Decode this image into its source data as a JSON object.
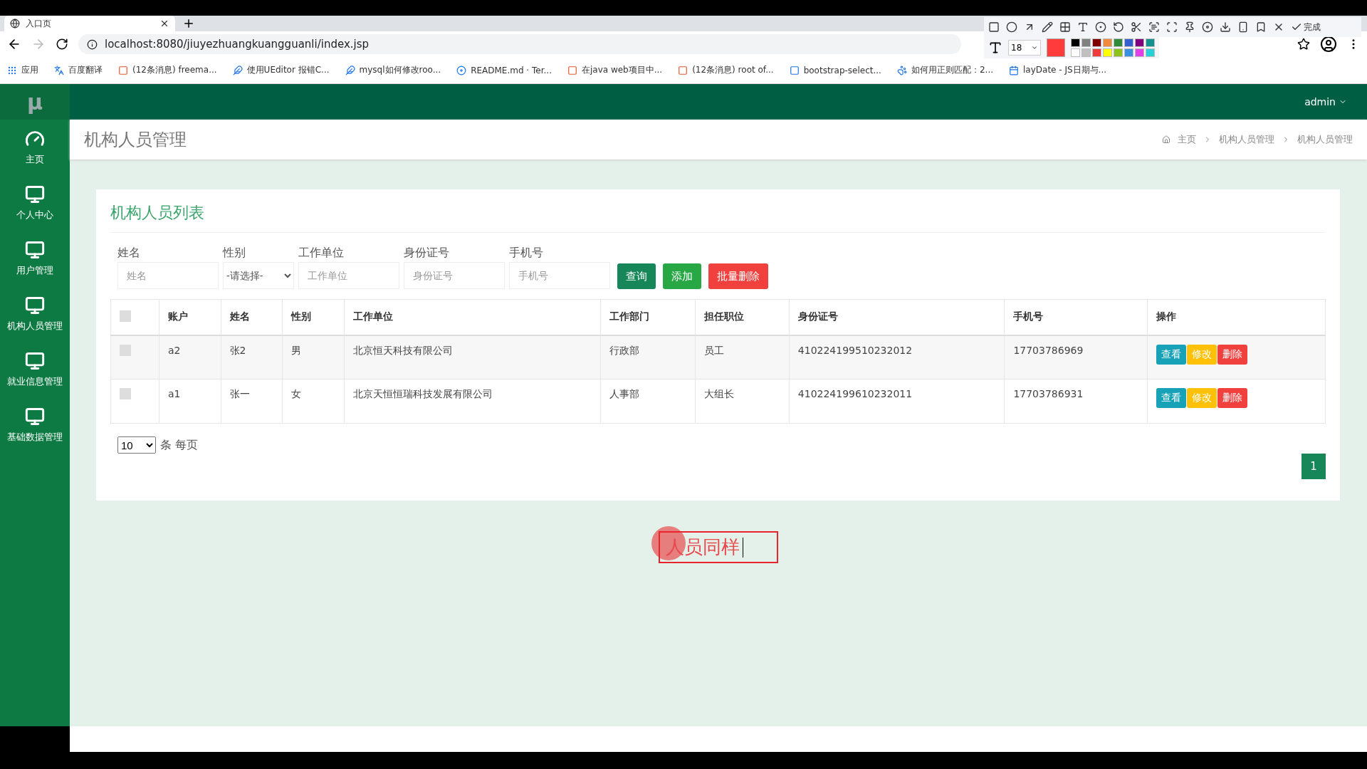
{
  "browser": {
    "tab_title": "入口页",
    "url": "localhost:8080/jiuyezhuangkuangguanli/index.jsp",
    "bookmarks": [
      {
        "label": "应用",
        "kind": "apps"
      },
      {
        "label": "百度翻译",
        "kind": "translate"
      },
      {
        "label": "(12条消息) freema...",
        "kind": "csdn"
      },
      {
        "label": "使用UEditor 报错C...",
        "kind": "feather"
      },
      {
        "label": "mysql如何修改roo...",
        "kind": "feather"
      },
      {
        "label": "README.md · Ter...",
        "kind": "gitee"
      },
      {
        "label": "在java web项目中...",
        "kind": "csdn"
      },
      {
        "label": "(12条消息) root of...",
        "kind": "csdn"
      },
      {
        "label": "bootstrap-select...",
        "kind": "jianshu"
      },
      {
        "label": "如何用正则匹配：2...",
        "kind": "paw"
      },
      {
        "label": "layDate - JS日期与...",
        "kind": "calendar"
      }
    ]
  },
  "annotation_toolbar": {
    "done_label": "完成",
    "font_size": "18",
    "current_color": {
      "color": "#ff3b3b"
    },
    "palette": [
      {
        "color": "#000000"
      },
      {
        "color": "#808080"
      },
      {
        "color": "#800000"
      },
      {
        "color": "#f08a3c"
      },
      {
        "color": "#2e8b3a"
      },
      {
        "color": "#3560d0"
      },
      {
        "color": "#800080"
      },
      {
        "color": "#129090"
      },
      {
        "color": "#ffffff"
      },
      {
        "color": "#c0c0c0"
      },
      {
        "color": "#ee3b3b"
      },
      {
        "color": "#ffff00"
      },
      {
        "color": "#8cc21b"
      },
      {
        "color": "#3b8fe0"
      },
      {
        "color": "#e040e8"
      },
      {
        "color": "#28d0d8"
      }
    ]
  },
  "app": {
    "logo": "μ",
    "user": "admin",
    "nav": [
      {
        "label": "主页",
        "kind": "dashboard"
      },
      {
        "label": "个人中心",
        "kind": "monitor"
      },
      {
        "label": "用户管理",
        "kind": "monitor"
      },
      {
        "label": "机构人员管理",
        "kind": "monitor"
      },
      {
        "label": "就业信息管理",
        "kind": "monitor"
      },
      {
        "label": "基础数据管理",
        "kind": "monitor"
      }
    ],
    "page_title": "机构人员管理",
    "breadcrumbs": [
      "主页",
      "机构人员管理",
      "机构人员管理"
    ],
    "card_title": "机构人员列表",
    "filters": [
      {
        "label": "姓名",
        "kind": "input",
        "placeholder": "姓名"
      },
      {
        "label": "性别",
        "kind": "select",
        "value": "-请选择-"
      },
      {
        "label": "工作单位",
        "kind": "input",
        "placeholder": "工作单位"
      },
      {
        "label": "身份证号",
        "kind": "input",
        "placeholder": "身份证号"
      },
      {
        "label": "手机号",
        "kind": "input",
        "placeholder": "手机号"
      }
    ],
    "buttons": [
      {
        "label": "查询",
        "kind": "primary"
      },
      {
        "label": "添加",
        "kind": "success"
      },
      {
        "label": "批量删除",
        "kind": "danger"
      }
    ],
    "table": {
      "header_checked": false,
      "columns": [
        "账户",
        "姓名",
        "性别",
        "工作单位",
        "工作部门",
        "担任职位",
        "身份证号",
        "手机号",
        "操作"
      ],
      "rows": [
        {
          "checked": false,
          "cells": [
            "a2",
            "张2",
            "男",
            "北京恒天科技有限公司",
            "行政部",
            "员工",
            "410224199510232012",
            "17703786969"
          ],
          "actions": [
            {
              "label": "查看",
              "kind": "info"
            },
            {
              "label": "修改",
              "kind": "warning"
            },
            {
              "label": "删除",
              "kind": "danger"
            }
          ]
        },
        {
          "checked": false,
          "cells": [
            "a1",
            "张一",
            "女",
            "北京天恒恒瑞科技发展有限公司",
            "人事部",
            "大组长",
            "410224199610232011",
            "17703786931"
          ],
          "actions": [
            {
              "label": "查看",
              "kind": "info"
            },
            {
              "label": "修改",
              "kind": "warning"
            },
            {
              "label": "删除",
              "kind": "danger"
            }
          ]
        }
      ]
    },
    "page_size": "10",
    "page_size_label": "条 每页",
    "pages": [
      {
        "label": "1",
        "selected": true
      }
    ]
  },
  "annotation": {
    "text": "人员同样"
  }
}
